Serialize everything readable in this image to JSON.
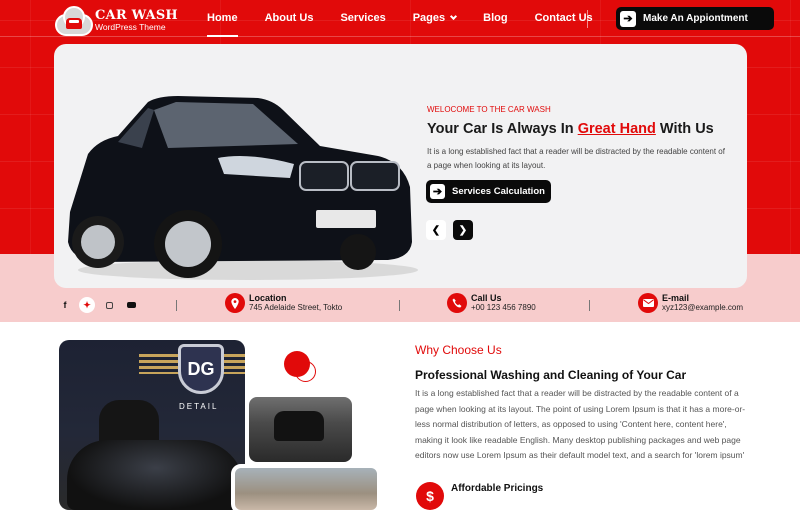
{
  "brand": {
    "title": "CAR WASH",
    "subtitle": "WordPress Theme"
  },
  "nav": {
    "items": [
      {
        "label": "Home",
        "active": true
      },
      {
        "label": "About Us"
      },
      {
        "label": "Services"
      },
      {
        "label": "Pages",
        "has_dropdown": true
      },
      {
        "label": "Blog"
      },
      {
        "label": "Contact Us"
      }
    ],
    "cta_label": "Make An Appiontment",
    "cta_icon": "arrow-right-icon"
  },
  "hero": {
    "eyebrow": "WELOCOME TO THE CAR WASH",
    "title_before": "Your Car Is Always In ",
    "title_highlight": "Great Hand",
    "title_after": " With Us",
    "description": "It is a long established fact that a reader will be distracted by the readable content of a page when looking at its layout.",
    "button_label": "Services Calculation",
    "prev_icon": "chevron-left-icon",
    "next_icon": "chevron-right-icon",
    "image": "black-suv-car"
  },
  "info_bar": {
    "social": [
      {
        "icon": "facebook-icon",
        "glyph": "f"
      },
      {
        "icon": "twitter-icon",
        "glyph": "🐦"
      },
      {
        "icon": "instagram-icon",
        "glyph": ""
      },
      {
        "icon": "youtube-icon",
        "glyph": ""
      }
    ],
    "location": {
      "label": "Location",
      "value": "745 Adelaide Street, Tokto"
    },
    "phone": {
      "label": "Call Us",
      "value": "+00 123 456 7890"
    },
    "email": {
      "label": "E-mail",
      "value": "xyz123@example.com"
    }
  },
  "why": {
    "tag": "Why Choose Us",
    "title": "Professional Washing and Cleaning of Your Car",
    "description": "It is a long established fact that a reader will be distracted by the readable content of a page when looking at its layout. The point of using Lorem Ipsum is that it has a more-or-less normal distribution of letters, as opposed to using 'Content here, content here', making it look like readable English. Many desktop publishing packages and web page editors now use Lorem Ipsum as their default model text, and a search for 'lorem ipsum'",
    "features": [
      {
        "icon": "dollar-icon",
        "glyph": "$",
        "title": "Affordable Pricings"
      }
    ],
    "images": {
      "shield_text": "DG",
      "banner_text": "DETAIL"
    }
  },
  "colors": {
    "accent": "#e10a0a",
    "dark": "#0a0a0a",
    "pink": "#f7cccc",
    "card": "#f2f2f3"
  }
}
